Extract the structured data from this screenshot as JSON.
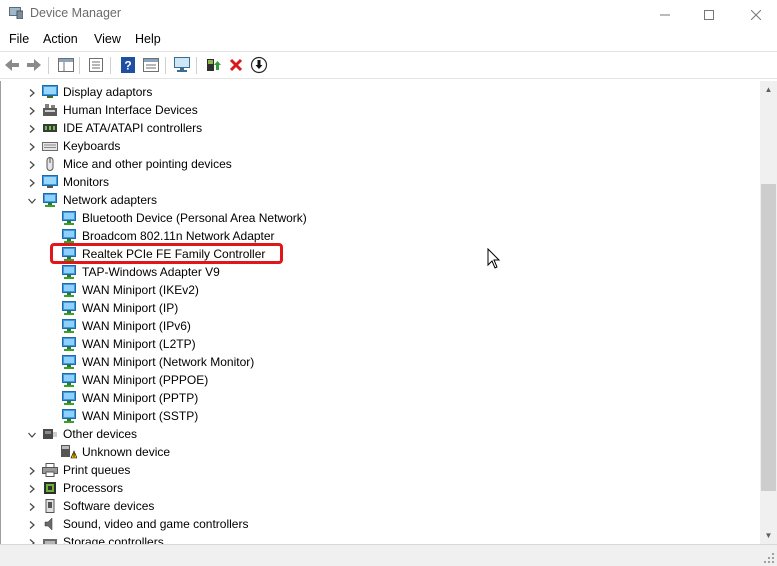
{
  "window": {
    "title": "Device Manager"
  },
  "menu": [
    "File",
    "Action",
    "View",
    "Help"
  ],
  "toolbar": {
    "buttons": [
      "back-icon",
      "forward-icon",
      "show-hide-tree-icon",
      "properties-icon",
      "help-icon",
      "view-icon",
      "scan-hardware-icon",
      "update-driver-icon",
      "uninstall-icon",
      "disable-device-icon"
    ]
  },
  "tree": {
    "items": [
      {
        "label": "Display adaptors",
        "level": 0,
        "expand": "collapsed",
        "icon": "display-icon"
      },
      {
        "label": "Human Interface Devices",
        "level": 0,
        "expand": "collapsed",
        "icon": "hid-icon"
      },
      {
        "label": "IDE ATA/ATAPI controllers",
        "level": 0,
        "expand": "collapsed",
        "icon": "ide-icon"
      },
      {
        "label": "Keyboards",
        "level": 0,
        "expand": "collapsed",
        "icon": "keyboard-icon"
      },
      {
        "label": "Mice and other pointing devices",
        "level": 0,
        "expand": "collapsed",
        "icon": "mouse-icon"
      },
      {
        "label": "Monitors",
        "level": 0,
        "expand": "collapsed",
        "icon": "monitor-icon"
      },
      {
        "label": "Network adapters",
        "level": 0,
        "expand": "expanded",
        "icon": "network-icon"
      },
      {
        "label": "Bluetooth Device (Personal Area Network)",
        "level": 1,
        "expand": "none",
        "icon": "network-icon"
      },
      {
        "label": "Broadcom 802.11n Network Adapter",
        "level": 1,
        "expand": "none",
        "icon": "network-icon"
      },
      {
        "label": "Realtek PCIe FE Family Controller",
        "level": 1,
        "expand": "none",
        "icon": "network-icon",
        "highlighted": true
      },
      {
        "label": "TAP-Windows Adapter V9",
        "level": 1,
        "expand": "none",
        "icon": "network-icon"
      },
      {
        "label": "WAN Miniport (IKEv2)",
        "level": 1,
        "expand": "none",
        "icon": "network-icon"
      },
      {
        "label": "WAN Miniport (IP)",
        "level": 1,
        "expand": "none",
        "icon": "network-icon"
      },
      {
        "label": "WAN Miniport (IPv6)",
        "level": 1,
        "expand": "none",
        "icon": "network-icon"
      },
      {
        "label": "WAN Miniport (L2TP)",
        "level": 1,
        "expand": "none",
        "icon": "network-icon"
      },
      {
        "label": "WAN Miniport (Network Monitor)",
        "level": 1,
        "expand": "none",
        "icon": "network-icon"
      },
      {
        "label": "WAN Miniport (PPPOE)",
        "level": 1,
        "expand": "none",
        "icon": "network-icon"
      },
      {
        "label": "WAN Miniport (PPTP)",
        "level": 1,
        "expand": "none",
        "icon": "network-icon"
      },
      {
        "label": "WAN Miniport (SSTP)",
        "level": 1,
        "expand": "none",
        "icon": "network-icon"
      },
      {
        "label": "Other devices",
        "level": 0,
        "expand": "expanded",
        "icon": "other-devices-icon"
      },
      {
        "label": "Unknown device",
        "level": 1,
        "expand": "none",
        "icon": "unknown-device-warning-icon"
      },
      {
        "label": "Print queues",
        "level": 0,
        "expand": "collapsed",
        "icon": "printer-icon"
      },
      {
        "label": "Processors",
        "level": 0,
        "expand": "collapsed",
        "icon": "processor-icon"
      },
      {
        "label": "Software devices",
        "level": 0,
        "expand": "collapsed",
        "icon": "software-device-icon"
      },
      {
        "label": "Sound, video and game controllers",
        "level": 0,
        "expand": "collapsed",
        "icon": "speaker-icon"
      },
      {
        "label": "Storage controllers",
        "level": 0,
        "expand": "collapsed",
        "icon": "storage-icon"
      }
    ]
  },
  "colors": {
    "highlight_border": "#e1151a",
    "network_icon": "#2b8fd6"
  }
}
